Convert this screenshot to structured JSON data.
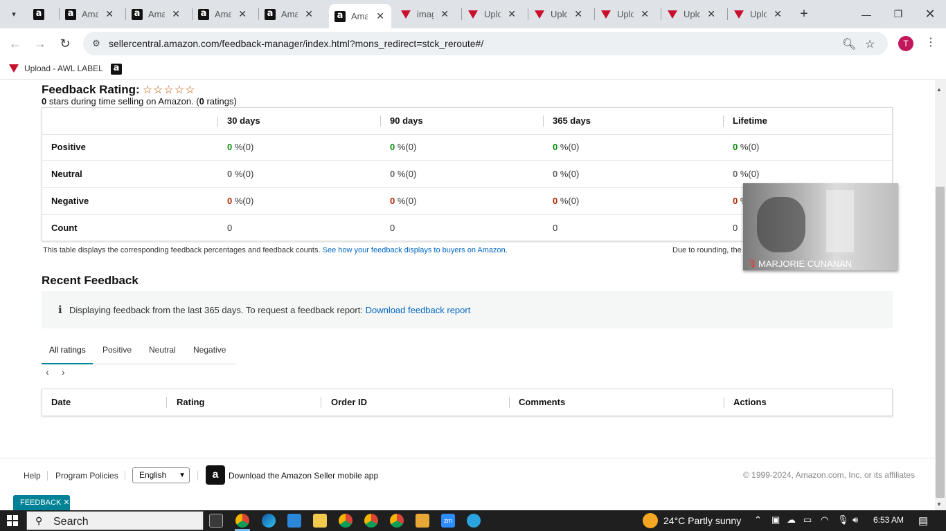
{
  "browser": {
    "tabs": [
      {
        "icon": "amazon-favicon",
        "title": "",
        "active": false
      },
      {
        "icon": "amazon-favicon",
        "title": "Ama",
        "active": false
      },
      {
        "icon": "amazon-favicon",
        "title": "Ama",
        "active": false
      },
      {
        "icon": "amazon-favicon",
        "title": "Ama",
        "active": false
      },
      {
        "icon": "amazon-favicon",
        "title": "Ama",
        "active": false
      },
      {
        "icon": "amazon-favicon",
        "title": "Ama",
        "active": true
      },
      {
        "icon": "awl-favicon",
        "title": "imag",
        "active": false
      },
      {
        "icon": "awl-favicon",
        "title": "Uplo",
        "active": false
      },
      {
        "icon": "awl-favicon",
        "title": "Uplo",
        "active": false
      },
      {
        "icon": "awl-favicon",
        "title": "Uplo",
        "active": false
      },
      {
        "icon": "awl-favicon",
        "title": "Uplo",
        "active": false
      },
      {
        "icon": "awl-favicon",
        "title": "Uplo",
        "active": false
      }
    ],
    "url": "sellercentral.amazon.com/feedback-manager/index.html?mons_redirect=stck_reroute#/",
    "profile_initial": "T",
    "bookmarks": [
      {
        "label": "Upload - AWL LABEL",
        "icon": "awl-favicon"
      },
      {
        "label": "",
        "icon": "amazon-favicon"
      }
    ]
  },
  "feedback": {
    "title": "Feedback Rating:",
    "stars": "☆☆☆☆☆",
    "summary_stars": "0",
    "summary_mid": " stars during time selling on Amazon. (",
    "summary_ratings": "0",
    "summary_end": " ratings)",
    "columns": [
      "30 days",
      "90 days",
      "365 days",
      "Lifetime"
    ],
    "rows": [
      {
        "label": "Positive",
        "values": [
          "0",
          "0",
          "0",
          "0"
        ],
        "suffix": " %(0)"
      },
      {
        "label": "Neutral",
        "values": [
          "0",
          "0",
          "0",
          "0"
        ],
        "suffix": " %(0)"
      },
      {
        "label": "Negative",
        "values": [
          "0",
          "0",
          "0",
          "0"
        ],
        "suffix": " %(0)"
      },
      {
        "label": "Count",
        "values": [
          "0",
          "0",
          "0",
          "0"
        ],
        "suffix": ""
      }
    ],
    "note_text": "This table displays the corresponding feedback percentages and feedback counts.",
    "note_link": "See how your feedback displays to buyers on Amazon.",
    "rounding_note": "Due to rounding, the"
  },
  "recent": {
    "title": "Recent Feedback",
    "info_icon": "i",
    "info_text": "Displaying feedback from the last 365 days. To request a feedback report:",
    "info_link": "Download feedback report",
    "tabs": [
      "All ratings",
      "Positive",
      "Neutral",
      "Negative"
    ],
    "active_tab": "All ratings",
    "table_headers": [
      "Date",
      "Rating",
      "Order ID",
      "Comments",
      "Actions"
    ]
  },
  "footer": {
    "help": "Help",
    "policies": "Program Policies",
    "language": "English",
    "app_text": "Download the Amazon Seller mobile app",
    "copyright": "© 1999-2024, Amazon.com, Inc. or its affiliates",
    "feedback_button": "FEEDBACK ✕"
  },
  "video": {
    "participant": "MARJORIE CUNANAN"
  },
  "taskbar": {
    "search": "Search",
    "weather": "24°C  Partly sunny",
    "time": "6:53 AM"
  }
}
